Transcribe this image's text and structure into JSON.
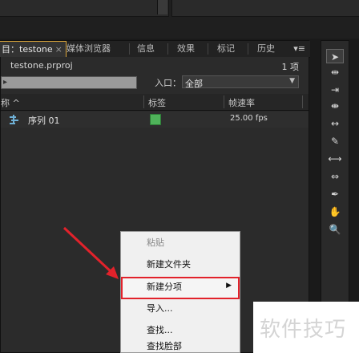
{
  "panel": {
    "tabs": [
      {
        "label": "目：testone"
      },
      {
        "label": "媒体浏览器"
      },
      {
        "label": "信息"
      },
      {
        "label": "效果"
      },
      {
        "label": "标记"
      },
      {
        "label": "历史"
      }
    ],
    "tab_close": "×",
    "menu_glyph": "▾≡",
    "project_file": "testone.prproj",
    "item_count": "1 项",
    "entry_label": "入口：",
    "entry_value": "全部",
    "columns": [
      "称 ^",
      "标签",
      "帧速率"
    ],
    "row": {
      "name": "序列 01",
      "label_color": "#4fb35a",
      "fps": "25.00 fps"
    }
  },
  "context_menu": {
    "items": [
      {
        "label": "粘贴",
        "disabled": true
      },
      {
        "label": "新建文件夹",
        "disabled": false
      },
      {
        "label": "新建分项",
        "disabled": false,
        "submenu": true
      },
      {
        "label": "导入...",
        "disabled": false
      },
      {
        "label": "查找...",
        "disabled": false
      },
      {
        "label": "查找脸部",
        "disabled": false
      }
    ]
  },
  "toolbar": {
    "tools": [
      "selection-tool",
      "track-select-tool",
      "ripple-edit-tool",
      "rolling-edit-tool",
      "rate-stretch-tool",
      "razor-tool",
      "slip-tool",
      "slide-tool",
      "pen-tool",
      "hand-tool",
      "zoom-tool"
    ]
  },
  "watermark": {
    "text": "软件技巧"
  },
  "colors": {
    "highlight_border": "#e2222b",
    "arrow": "#e2222b",
    "label_green": "#4fb35a"
  }
}
